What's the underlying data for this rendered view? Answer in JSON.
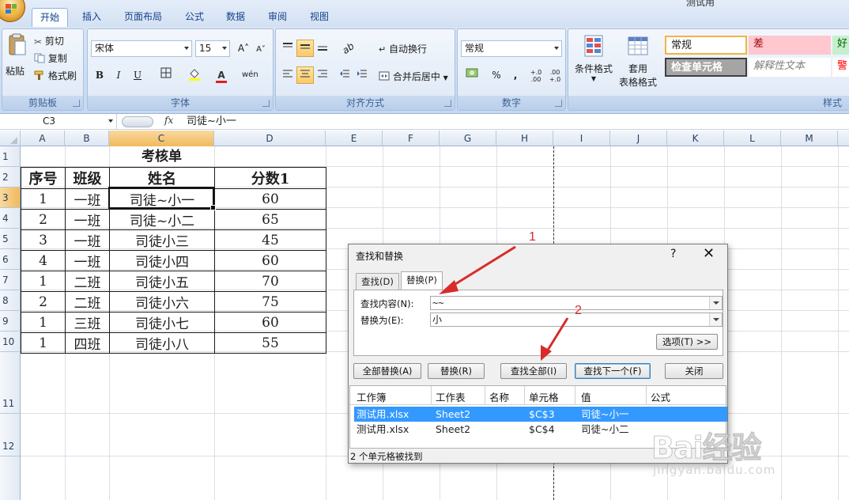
{
  "window": {
    "doc_title": "测试用"
  },
  "ribbon": {
    "tabs": [
      "开始",
      "插入",
      "页面布局",
      "公式",
      "数据",
      "审阅",
      "视图"
    ],
    "clipboard": {
      "paste": "粘贴",
      "cut": "剪切",
      "copy": "复制",
      "format_painter": "格式刷",
      "label": "剪贴板"
    },
    "font": {
      "name": "宋体",
      "size": "15",
      "bold": "B",
      "italic": "I",
      "underline": "U",
      "label": "字体",
      "grow": "A˄",
      "shrink": "A˅"
    },
    "alignment": {
      "wrap": "自动换行",
      "merge": "合并后居中",
      "label": "对齐方式"
    },
    "number": {
      "format": "常规",
      "percent": "%",
      "comma": ",",
      "inc_dec": "+.0 .00",
      "dec_dec": ".00 +.0",
      "label": "数字"
    },
    "styles": {
      "conditional": "条件格式",
      "table_format_1": "套用",
      "table_format_2": "表格格式",
      "cell_styles": [
        "常规",
        "差",
        "好",
        "检查单元格",
        "解释性文本",
        "警"
      ],
      "label": "样式"
    }
  },
  "formula_bar": {
    "name_box": "C3",
    "fx": "fx",
    "content": "司徒~小一"
  },
  "grid": {
    "columns": [
      "A",
      "B",
      "C",
      "D",
      "E",
      "F",
      "G",
      "H",
      "I",
      "J",
      "K",
      "L",
      "M"
    ],
    "selected_column": "C",
    "rows": [
      "1",
      "2",
      "3",
      "4",
      "5",
      "6",
      "7",
      "8",
      "9",
      "10",
      "11",
      "12"
    ],
    "selected_row": "3"
  },
  "sheet": {
    "title": "考核单",
    "headers": [
      "序号",
      "班级",
      "姓名",
      "分数1"
    ],
    "rows": [
      [
        "1",
        "一班",
        "司徒~小一",
        "60"
      ],
      [
        "2",
        "一班",
        "司徒~小二",
        "65"
      ],
      [
        "3",
        "一班",
        "司徒小三",
        "45"
      ],
      [
        "4",
        "一班",
        "司徒小四",
        "60"
      ],
      [
        "1",
        "二班",
        "司徒小五",
        "70"
      ],
      [
        "2",
        "二班",
        "司徒小六",
        "75"
      ],
      [
        "1",
        "三班",
        "司徒小七",
        "60"
      ],
      [
        "1",
        "四班",
        "司徒小八",
        "55"
      ]
    ]
  },
  "dialog": {
    "title": "查找和替换",
    "help": "?",
    "close": "✕",
    "tabs": [
      "查找(D)",
      "替换(P)"
    ],
    "find_label": "查找内容(N):",
    "find_value": "~~",
    "replace_label": "替换为(E):",
    "replace_value": "小",
    "options_button": "选项(T) >>",
    "buttons": [
      "全部替换(A)",
      "替换(R)",
      "查找全部(I)",
      "查找下一个(F)",
      "关闭"
    ],
    "result_columns": [
      "工作簿",
      "工作表",
      "名称",
      "单元格",
      "值",
      "公式"
    ],
    "results": [
      {
        "workbook": "测试用.xlsx",
        "sheet": "Sheet2",
        "name": "",
        "cell": "$C$3",
        "value": "司徒~小一",
        "formula": ""
      },
      {
        "workbook": "测试用.xlsx",
        "sheet": "Sheet2",
        "name": "",
        "cell": "$C$4",
        "value": "司徒~小二",
        "formula": ""
      }
    ],
    "status": "2 个单元格被找到"
  },
  "annotations": {
    "marker1": "1",
    "marker2": "2",
    "color": "#d92b2b"
  },
  "watermark": {
    "brand": "Bai经验",
    "url": "jingyan.baidu.com"
  }
}
